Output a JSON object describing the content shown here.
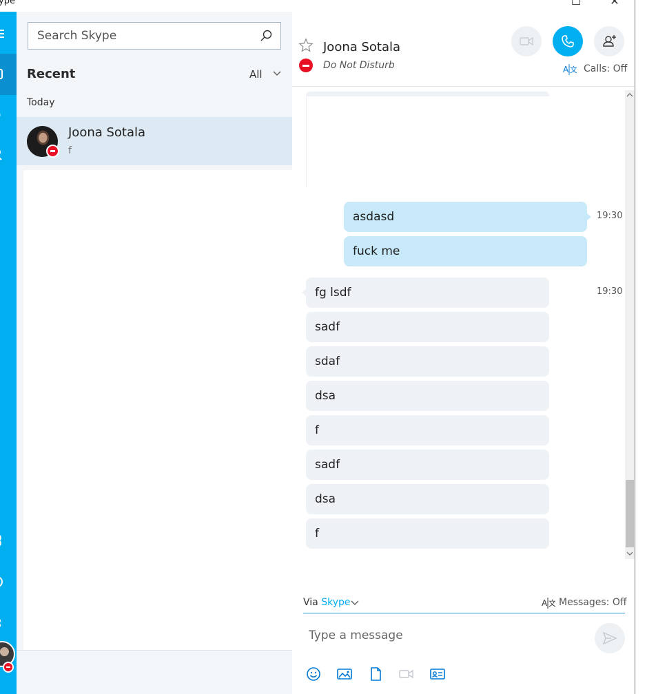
{
  "window": {
    "app_title": "ype",
    "maximize_glyph": "☐",
    "close_glyph": "✕"
  },
  "colors": {
    "accent": "#00aff0",
    "accent_dark": "#0a8fd0",
    "outgoing_bubble": "#c7e9f9",
    "incoming_bubble": "#eef1f5",
    "dnd_red": "#e81123",
    "sidebar_bg": "#f3f6f9",
    "selected_row": "#dde9f3"
  },
  "rail": {
    "icons": [
      "menu-icon",
      "chats-icon",
      "calls-icon",
      "contacts-icon",
      "bots-icon",
      "help-icon",
      "notifications-icon"
    ]
  },
  "sidebar": {
    "search_placeholder": "Search Skype",
    "recent_title": "Recent",
    "filter_label": "All",
    "group_label": "Today",
    "contacts": [
      {
        "name": "Joona Sotala",
        "preview": "f",
        "status": "do-not-disturb"
      }
    ]
  },
  "header": {
    "contact_name": "Joona Sotala",
    "status_text": "Do Not Disturb",
    "calls_translation": "Calls: Off"
  },
  "messages": {
    "outgoing_time": "19:30",
    "incoming_time": "19:30",
    "outgoing": [
      "asdasd",
      "fuck me"
    ],
    "incoming": [
      "fg lsdf",
      "sadf",
      "sdaf",
      "dsa",
      "f",
      "sadf",
      "dsa",
      "f"
    ]
  },
  "compose": {
    "via_prefix": "Via",
    "via_service": "Skype",
    "messages_translation": "Messages: Off",
    "placeholder": "Type a message",
    "tools": [
      "emoji-icon",
      "image-icon",
      "file-icon",
      "video-message-icon",
      "contact-card-icon"
    ]
  }
}
